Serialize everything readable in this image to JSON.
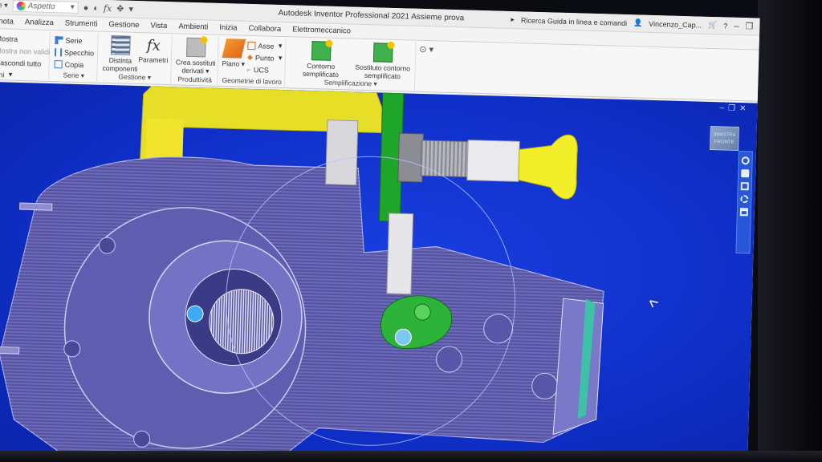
{
  "window": {
    "title": "Autodesk Inventor Professional 2021   Assieme prova",
    "appearance": "Aspetto",
    "search": "Ricerca Guida in linea e comandi",
    "user": "Vincenzo_Cap..."
  },
  "menu": [
    "nnota",
    "Analizza",
    "Strumenti",
    "Gestione",
    "Vista",
    "Ambienti",
    "Inizia",
    "Collabora",
    "Elettromeccanico"
  ],
  "ribbon": {
    "visibility": {
      "show": "Mostra",
      "show_hidden": "Mostra non validi",
      "hide_all": "Nascondi tutto",
      "dropdown": "oni"
    },
    "series": {
      "items": [
        "Serie",
        "Specchio",
        "Copia"
      ],
      "label": "Serie"
    },
    "management": {
      "bom": "Distinta componenti",
      "params": "Parametri",
      "label": "Gestione"
    },
    "productivity": {
      "derived": "Crea sostituti derivati",
      "label": "Produttività"
    },
    "work_geometry": {
      "plane": "Piano",
      "axis": "Asse",
      "point": "Punto",
      "ucs": "UCS",
      "label": "Geometrie di lavoro"
    },
    "simplification": {
      "envelope": "Contorno semplificato",
      "substitute": "Sostituto contorno semplificato",
      "label": "Semplificazione"
    }
  },
  "viewcube": "SINISTRA FRONTE",
  "colors": {
    "viewport": "#0f2fc8",
    "part_body": "#6c6ab9",
    "bracket": "#e8e22a",
    "green_part": "#1ea52a",
    "knob": "#f3ee2a"
  }
}
